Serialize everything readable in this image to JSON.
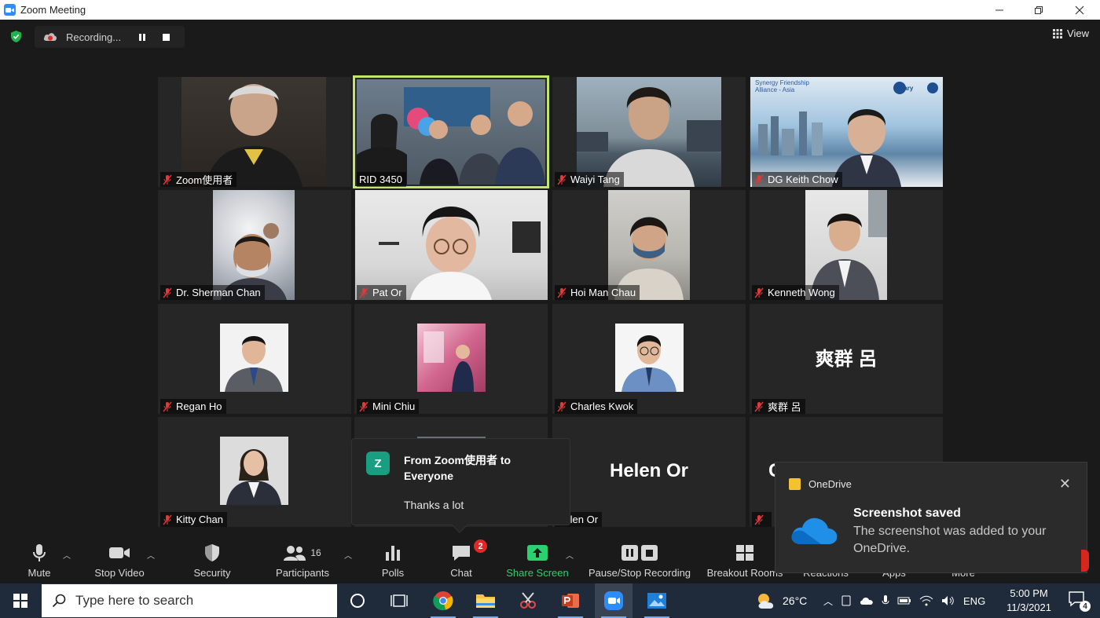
{
  "window": {
    "title": "Zoom Meeting"
  },
  "meeting": {
    "recording_label": "Recording...",
    "view_label": "View",
    "participants": [
      {
        "name": "Zoom使用者",
        "has_video": true
      },
      {
        "name": "RID 3450",
        "has_video": true,
        "active_speaker": true
      },
      {
        "name": "Waiyi Tang",
        "has_video": true
      },
      {
        "name": "DG Keith Chow",
        "has_video": true
      },
      {
        "name": "Dr. Sherman Chan",
        "has_video": true
      },
      {
        "name": "Pat Or",
        "has_video": true
      },
      {
        "name": "Hoi Man Chau",
        "has_video": true
      },
      {
        "name": "Kenneth Wong",
        "has_video": true
      },
      {
        "name": "Regan Ho",
        "has_video": false
      },
      {
        "name": "Mini Chiu",
        "has_video": false
      },
      {
        "name": "Charles Kwok",
        "has_video": false
      },
      {
        "name": "爽群 呂",
        "display_text": "爽群 呂",
        "has_video": false
      },
      {
        "name": "Kitty Chan",
        "has_video": false
      },
      {
        "name": "",
        "has_video": false
      },
      {
        "name": "Helen Or",
        "display_text": "Helen Or",
        "has_video": false
      },
      {
        "name": "",
        "display_text": "C",
        "has_video": false
      }
    ],
    "slide_text": {
      "line1": "Synergy Friendship",
      "line2": "Alliance - Asia",
      "brand": "Rotary"
    }
  },
  "chat_popup": {
    "avatar_letter": "Z",
    "from": "From Zoom使用者 to Everyone",
    "message": "Thanks a lot"
  },
  "toast": {
    "source": "OneDrive",
    "title": "Screenshot saved",
    "body": "The screenshot was added to your OneDrive."
  },
  "toolbar": {
    "mute": "Mute",
    "stop_video": "Stop Video",
    "security": "Security",
    "participants": "Participants",
    "participants_count": "16",
    "polls": "Polls",
    "chat": "Chat",
    "chat_badge": "2",
    "share_screen": "Share Screen",
    "pause_stop_recording": "Pause/Stop Recording",
    "breakout_rooms": "Breakout Rooms",
    "reactions": "Reactions",
    "apps": "Apps",
    "more": "More"
  },
  "taskbar": {
    "search_placeholder": "Type here to search",
    "temperature": "26°C",
    "language": "ENG",
    "time": "5:00 PM",
    "date": "11/3/2021",
    "notification_count": "4"
  },
  "colors": {
    "active_speaker_border": "#c2e56b",
    "share_green": "#2bd16f",
    "chat_avatar": "#1a9e82",
    "badge_red": "#e02828",
    "zoom_blue": "#2d8cff",
    "taskbar": "#1f2a3a"
  }
}
